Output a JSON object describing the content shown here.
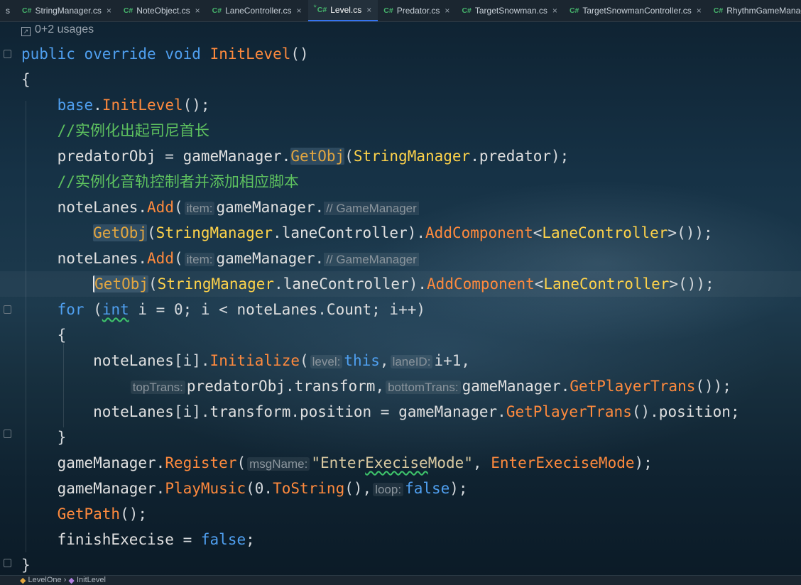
{
  "tabs": [
    {
      "lang": "",
      "label": "s",
      "modified": false,
      "active": false
    },
    {
      "lang": "C#",
      "label": "StringManager.cs",
      "modified": false,
      "active": false
    },
    {
      "lang": "C#",
      "label": "NoteObject.cs",
      "modified": false,
      "active": false
    },
    {
      "lang": "C#",
      "label": "LaneController.cs",
      "modified": false,
      "active": false
    },
    {
      "lang": "C#",
      "label": "Level.cs",
      "modified": true,
      "active": true
    },
    {
      "lang": "C#",
      "label": "Predator.cs",
      "modified": false,
      "active": false
    },
    {
      "lang": "C#",
      "label": "TargetSnowman.cs",
      "modified": false,
      "active": false
    },
    {
      "lang": "C#",
      "label": "TargetSnowmanController.cs",
      "modified": false,
      "active": false
    },
    {
      "lang": "C#",
      "label": "RhythmGameManager.cs",
      "modified": false,
      "active": false
    }
  ],
  "close_glyph": "×",
  "mod_glyph": "*",
  "usages": "0+2 usages",
  "code": {
    "kw_public": "public",
    "kw_override": "override",
    "kw_void": "void",
    "fn_initlevel": "InitLevel",
    "parens": "()",
    "brace_open": "{",
    "brace_close": "}",
    "kw_base": "base",
    "dot": ".",
    "call_end": "();",
    "comment1": "//实例化出起司尼首长",
    "predatorObj": "predatorObj",
    "assign": " = ",
    "gameManager": "gameManager",
    "getObj": "GetObj",
    "paren_open": "(",
    "stringManager": "StringManager",
    "predator": "predator",
    "close_semi": ");",
    "comment2": "//实例化音轨控制者并添加相应脚本",
    "noteLanes": "noteLanes",
    "add": "Add",
    "hint_item": "item:",
    "hint_gm_comment": "// GameManager",
    "laneController_field": "laneController",
    "close_paren": ")",
    "addComponent": "AddComponent",
    "lt": "<",
    "laneController_type": "LaneController",
    "gt_close": ">());",
    "kw_for": "for",
    "for_open": " (",
    "kw_int": "int",
    "for_mid1": " i = 0; i < ",
    "count": "Count",
    "for_end": "; i++)",
    "idx": "[i]",
    "initialize": "Initialize",
    "hint_level": "level:",
    "kw_this": "this",
    "comma": ",",
    "hint_laneID": "laneID:",
    "laneid_val": "i+1,",
    "hint_topTrans": "topTrans:",
    "transform": "transform",
    "hint_bottomTrans": "bottomTrans:",
    "getPlayerTrans": "GetPlayerTrans",
    "close_double": "());",
    "position": "position",
    "register": "Register",
    "hint_msgName": "msgName:",
    "str_q_open": "\"Enter",
    "str_execise": "Execise",
    "str_rest": "Mode\"",
    "comma_sp": ", ",
    "enterExeciseMode": "EnterExeciseMode",
    "playMusic": "PlayMusic",
    "zero": "0",
    "toString": "ToString",
    "hint_loop": "loop:",
    "kw_false": "false",
    "getPath": "GetPath",
    "finishExecise": "finishExecise",
    "semi": ";"
  },
  "breadcrumb": {
    "class_name": "LevelOne",
    "separator": "›",
    "method_name": "InitLevel"
  }
}
